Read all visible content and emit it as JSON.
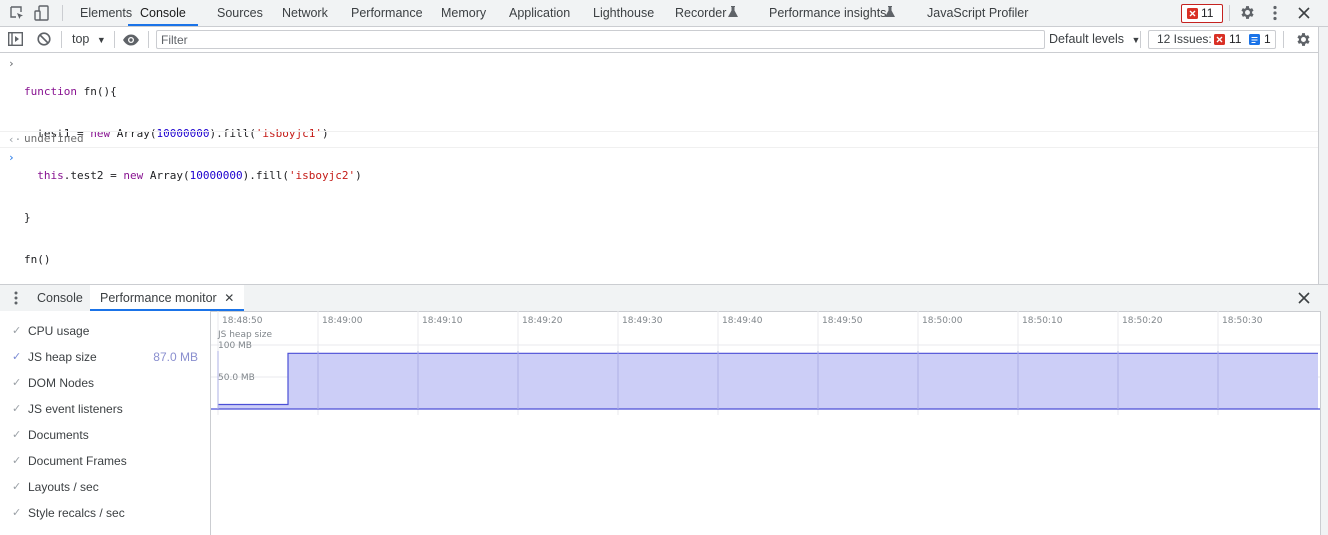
{
  "main_tabs": [
    {
      "label": "Elements"
    },
    {
      "label": "Console",
      "active": true
    },
    {
      "label": "Sources"
    },
    {
      "label": "Network"
    },
    {
      "label": "Performance"
    },
    {
      "label": "Memory"
    },
    {
      "label": "Application"
    },
    {
      "label": "Lighthouse"
    },
    {
      "label": "Recorder"
    },
    {
      "label": "Performance insights"
    },
    {
      "label": "JavaScript Profiler"
    }
  ],
  "error_badge": {
    "count": "11"
  },
  "console_toolbar": {
    "context": "top",
    "filter_placeholder": "Filter",
    "levels": "Default levels",
    "issues_label": "12 Issues:",
    "issues_errors": "11",
    "issues_info": "1"
  },
  "console": {
    "input_lines": [
      "function fn(){",
      "  test1 = new Array(10000000).fill('isboyjc1')",
      "  this.test2 = new Array(10000000).fill('isboyjc2')",
      "}",
      "fn()"
    ],
    "result": "undefined"
  },
  "drawer": {
    "tabs": [
      {
        "label": "Console"
      },
      {
        "label": "Performance monitor",
        "active": true
      }
    ]
  },
  "perf_monitor": {
    "metrics": [
      {
        "label": "CPU usage",
        "checked": false,
        "value": ""
      },
      {
        "label": "JS heap size",
        "checked": true,
        "value": "87.0 MB"
      },
      {
        "label": "DOM Nodes",
        "checked": false,
        "value": ""
      },
      {
        "label": "JS event listeners",
        "checked": false,
        "value": ""
      },
      {
        "label": "Documents",
        "checked": false,
        "value": ""
      },
      {
        "label": "Document Frames",
        "checked": false,
        "value": ""
      },
      {
        "label": "Layouts / sec",
        "checked": false,
        "value": ""
      },
      {
        "label": "Style recalcs / sec",
        "checked": false,
        "value": ""
      }
    ],
    "time_ticks": [
      "18:48:50",
      "18:49:00",
      "18:49:10",
      "18:49:20",
      "18:49:30",
      "18:49:40",
      "18:49:50",
      "18:50:00",
      "18:50:10",
      "18:50:20",
      "18:50:30"
    ],
    "chart_label": "JS heap size",
    "y_ticks": [
      "100 MB",
      "50.0 MB"
    ],
    "colors": {
      "heap_fill": "#c9cbf7",
      "heap_line": "#4b4fd6",
      "accent": "#1a73e8"
    }
  },
  "chart_data": {
    "type": "area",
    "title": "JS heap size",
    "x_label": "",
    "y_label": "",
    "x_ticks": [
      "18:48:50",
      "18:49:00",
      "18:49:10",
      "18:49:20",
      "18:49:30",
      "18:49:40",
      "18:49:50",
      "18:50:00",
      "18:50:10",
      "18:50:20",
      "18:50:30"
    ],
    "y_ticks": [
      "100 MB",
      "50.0 MB"
    ],
    "ylim": [
      0,
      100
    ],
    "series": [
      {
        "name": "JS heap size",
        "unit": "MB",
        "x": [
          "18:48:50",
          "18:48:57",
          "18:48:57",
          "18:50:40"
        ],
        "y": [
          7,
          7,
          87,
          87
        ]
      }
    ]
  }
}
